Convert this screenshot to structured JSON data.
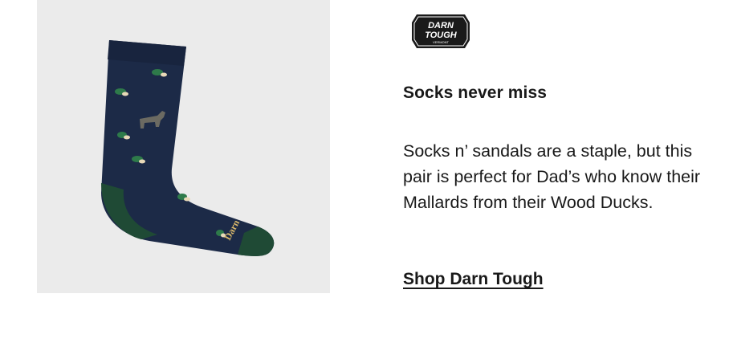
{
  "product": {
    "image_description_name": "navy-crew-sock-with-mallard-duck-and-moose-print",
    "brand_lettering_on_sock": "Darn"
  },
  "brand": {
    "logo_line1": "DARN",
    "logo_line2": "TOUGH",
    "logo_line3": "VERMONT"
  },
  "content": {
    "headline": "Socks never miss",
    "body": "Socks n’ sandals are a staple, but this pair is perfect for Dad’s who know their Mallards from their Wood Ducks.",
    "cta_label": "Shop Darn Tough"
  },
  "colors": {
    "sock_navy": "#1c2a47",
    "sock_green": "#1f4a35",
    "image_background": "#ebebeb",
    "text": "#191919"
  }
}
